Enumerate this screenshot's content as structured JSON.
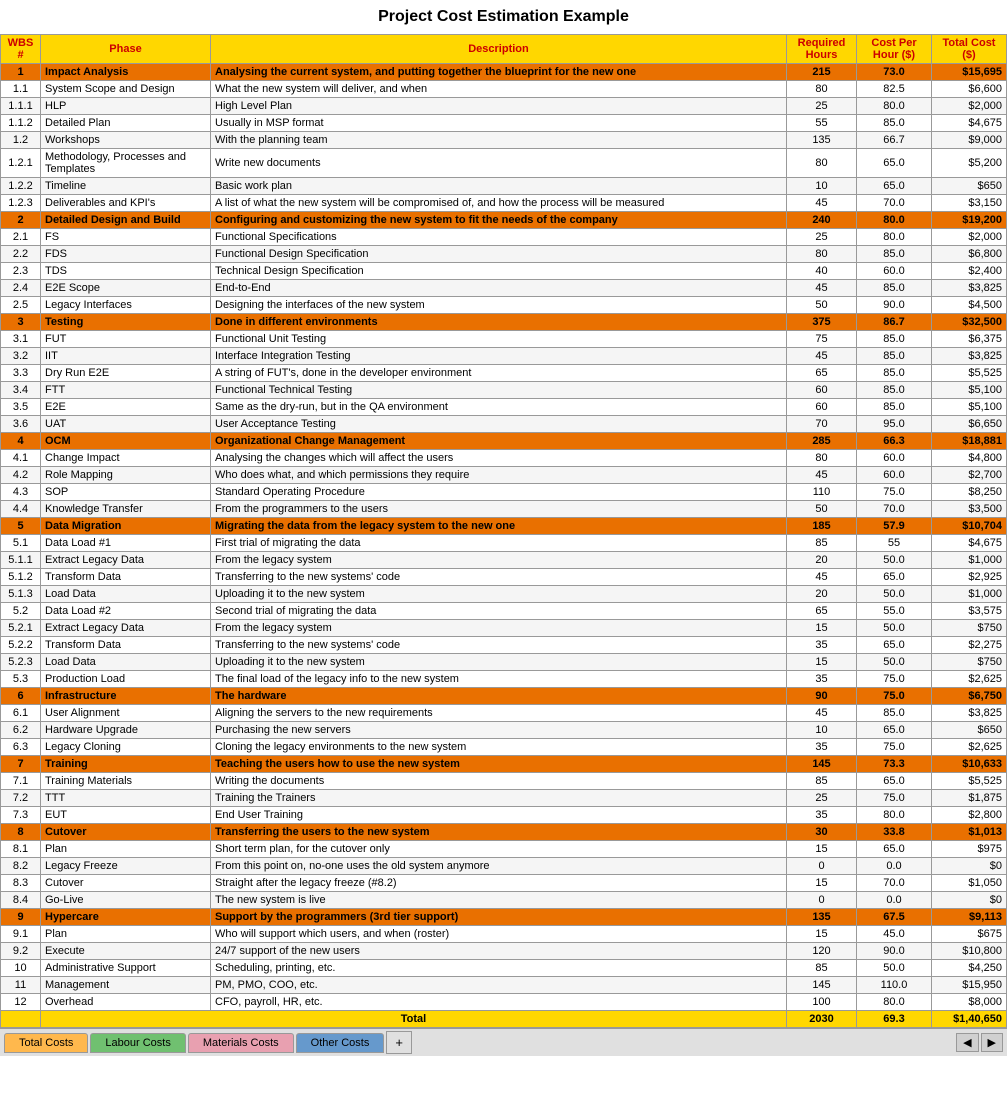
{
  "title": "Project Cost Estimation Example",
  "headers": {
    "wbs": "WBS #",
    "phase": "Phase",
    "description": "Description",
    "required_hours": "Required Hours",
    "cost_per_hour": "Cost Per Hour ($)",
    "total_cost": "Total Cost ($)"
  },
  "rows": [
    {
      "wbs": "1",
      "phase": "Impact Analysis",
      "desc": "Analysing the current system, and putting together the blueprint for the new one",
      "hours": "215",
      "cph": "73.0",
      "total": "$15,695",
      "type": "phase"
    },
    {
      "wbs": "1.1",
      "phase": "System Scope and Design",
      "desc": "What the new system will deliver, and when",
      "hours": "80",
      "cph": "82.5",
      "total": "$6,600",
      "type": "sub"
    },
    {
      "wbs": "1.1.1",
      "phase": "HLP",
      "desc": "High Level Plan",
      "hours": "25",
      "cph": "80.0",
      "total": "$2,000",
      "type": "alt"
    },
    {
      "wbs": "1.1.2",
      "phase": "Detailed Plan",
      "desc": "Usually in MSP format",
      "hours": "55",
      "cph": "85.0",
      "total": "$4,675",
      "type": "sub"
    },
    {
      "wbs": "1.2",
      "phase": "Workshops",
      "desc": "With the planning team",
      "hours": "135",
      "cph": "66.7",
      "total": "$9,000",
      "type": "alt"
    },
    {
      "wbs": "1.2.1",
      "phase": "Methodology, Processes and Templates",
      "desc": "Write new documents",
      "hours": "80",
      "cph": "65.0",
      "total": "$5,200",
      "type": "sub"
    },
    {
      "wbs": "1.2.2",
      "phase": "Timeline",
      "desc": "Basic work plan",
      "hours": "10",
      "cph": "65.0",
      "total": "$650",
      "type": "alt"
    },
    {
      "wbs": "1.2.3",
      "phase": "Deliverables and KPI's",
      "desc": "A list of what the new system will be compromised of, and how the process will be measured",
      "hours": "45",
      "cph": "70.0",
      "total": "$3,150",
      "type": "sub"
    },
    {
      "wbs": "2",
      "phase": "Detailed Design and Build",
      "desc": "Configuring and customizing the new system to fit the needs of the company",
      "hours": "240",
      "cph": "80.0",
      "total": "$19,200",
      "type": "phase"
    },
    {
      "wbs": "2.1",
      "phase": "FS",
      "desc": "Functional Specifications",
      "hours": "25",
      "cph": "80.0",
      "total": "$2,000",
      "type": "sub"
    },
    {
      "wbs": "2.2",
      "phase": "FDS",
      "desc": "Functional Design Specification",
      "hours": "80",
      "cph": "85.0",
      "total": "$6,800",
      "type": "alt"
    },
    {
      "wbs": "2.3",
      "phase": "TDS",
      "desc": "Technical Design Specification",
      "hours": "40",
      "cph": "60.0",
      "total": "$2,400",
      "type": "sub"
    },
    {
      "wbs": "2.4",
      "phase": "E2E Scope",
      "desc": "End-to-End",
      "hours": "45",
      "cph": "85.0",
      "total": "$3,825",
      "type": "alt"
    },
    {
      "wbs": "2.5",
      "phase": "Legacy Interfaces",
      "desc": "Designing the interfaces of the new system",
      "hours": "50",
      "cph": "90.0",
      "total": "$4,500",
      "type": "sub"
    },
    {
      "wbs": "3",
      "phase": "Testing",
      "desc": "Done in different environments",
      "hours": "375",
      "cph": "86.7",
      "total": "$32,500",
      "type": "phase"
    },
    {
      "wbs": "3.1",
      "phase": "FUT",
      "desc": "Functional Unit Testing",
      "hours": "75",
      "cph": "85.0",
      "total": "$6,375",
      "type": "sub"
    },
    {
      "wbs": "3.2",
      "phase": "IIT",
      "desc": "Interface Integration Testing",
      "hours": "45",
      "cph": "85.0",
      "total": "$3,825",
      "type": "alt"
    },
    {
      "wbs": "3.3",
      "phase": "Dry Run E2E",
      "desc": "A string of FUT's, done in the developer environment",
      "hours": "65",
      "cph": "85.0",
      "total": "$5,525",
      "type": "sub"
    },
    {
      "wbs": "3.4",
      "phase": "FTT",
      "desc": "Functional Technical Testing",
      "hours": "60",
      "cph": "85.0",
      "total": "$5,100",
      "type": "alt"
    },
    {
      "wbs": "3.5",
      "phase": "E2E",
      "desc": "Same as the dry-run, but in the QA environment",
      "hours": "60",
      "cph": "85.0",
      "total": "$5,100",
      "type": "sub"
    },
    {
      "wbs": "3.6",
      "phase": "UAT",
      "desc": "User Acceptance Testing",
      "hours": "70",
      "cph": "95.0",
      "total": "$6,650",
      "type": "alt"
    },
    {
      "wbs": "4",
      "phase": "OCM",
      "desc": "Organizational Change Management",
      "hours": "285",
      "cph": "66.3",
      "total": "$18,881",
      "type": "phase"
    },
    {
      "wbs": "4.1",
      "phase": "Change Impact",
      "desc": "Analysing the changes which will affect the users",
      "hours": "80",
      "cph": "60.0",
      "total": "$4,800",
      "type": "sub"
    },
    {
      "wbs": "4.2",
      "phase": "Role Mapping",
      "desc": "Who does what, and which permissions they require",
      "hours": "45",
      "cph": "60.0",
      "total": "$2,700",
      "type": "alt"
    },
    {
      "wbs": "4.3",
      "phase": "SOP",
      "desc": "Standard Operating Procedure",
      "hours": "110",
      "cph": "75.0",
      "total": "$8,250",
      "type": "sub"
    },
    {
      "wbs": "4.4",
      "phase": "Knowledge Transfer",
      "desc": "From the programmers to the users",
      "hours": "50",
      "cph": "70.0",
      "total": "$3,500",
      "type": "alt"
    },
    {
      "wbs": "5",
      "phase": "Data Migration",
      "desc": "Migrating the data from the legacy system to the new one",
      "hours": "185",
      "cph": "57.9",
      "total": "$10,704",
      "type": "phase"
    },
    {
      "wbs": "5.1",
      "phase": "Data Load #1",
      "desc": "First trial of migrating the data",
      "hours": "85",
      "cph": "55",
      "total": "$4,675",
      "type": "sub"
    },
    {
      "wbs": "5.1.1",
      "phase": "Extract Legacy Data",
      "desc": "From the legacy system",
      "hours": "20",
      "cph": "50.0",
      "total": "$1,000",
      "type": "alt"
    },
    {
      "wbs": "5.1.2",
      "phase": "Transform Data",
      "desc": "Transferring to the new systems' code",
      "hours": "45",
      "cph": "65.0",
      "total": "$2,925",
      "type": "sub"
    },
    {
      "wbs": "5.1.3",
      "phase": "Load Data",
      "desc": "Uploading it to the new system",
      "hours": "20",
      "cph": "50.0",
      "total": "$1,000",
      "type": "alt"
    },
    {
      "wbs": "5.2",
      "phase": "Data Load #2",
      "desc": "Second trial of migrating the data",
      "hours": "65",
      "cph": "55.0",
      "total": "$3,575",
      "type": "sub"
    },
    {
      "wbs": "5.2.1",
      "phase": "Extract Legacy Data",
      "desc": "From the legacy system",
      "hours": "15",
      "cph": "50.0",
      "total": "$750",
      "type": "alt"
    },
    {
      "wbs": "5.2.2",
      "phase": "Transform Data",
      "desc": "Transferring to the new systems' code",
      "hours": "35",
      "cph": "65.0",
      "total": "$2,275",
      "type": "sub"
    },
    {
      "wbs": "5.2.3",
      "phase": "Load Data",
      "desc": "Uploading it to the new system",
      "hours": "15",
      "cph": "50.0",
      "total": "$750",
      "type": "alt"
    },
    {
      "wbs": "5.3",
      "phase": "Production Load",
      "desc": "The final load of the legacy info to the new system",
      "hours": "35",
      "cph": "75.0",
      "total": "$2,625",
      "type": "sub"
    },
    {
      "wbs": "6",
      "phase": "Infrastructure",
      "desc": "The hardware",
      "hours": "90",
      "cph": "75.0",
      "total": "$6,750",
      "type": "phase"
    },
    {
      "wbs": "6.1",
      "phase": "User Alignment",
      "desc": "Aligning the servers to the new requirements",
      "hours": "45",
      "cph": "85.0",
      "total": "$3,825",
      "type": "sub"
    },
    {
      "wbs": "6.2",
      "phase": "Hardware Upgrade",
      "desc": "Purchasing the new servers",
      "hours": "10",
      "cph": "65.0",
      "total": "$650",
      "type": "alt"
    },
    {
      "wbs": "6.3",
      "phase": "Legacy Cloning",
      "desc": "Cloning the legacy environments to the new system",
      "hours": "35",
      "cph": "75.0",
      "total": "$2,625",
      "type": "sub"
    },
    {
      "wbs": "7",
      "phase": "Training",
      "desc": "Teaching the users how to use the new system",
      "hours": "145",
      "cph": "73.3",
      "total": "$10,633",
      "type": "phase"
    },
    {
      "wbs": "7.1",
      "phase": "Training Materials",
      "desc": "Writing the documents",
      "hours": "85",
      "cph": "65.0",
      "total": "$5,525",
      "type": "sub"
    },
    {
      "wbs": "7.2",
      "phase": "TTT",
      "desc": "Training the Trainers",
      "hours": "25",
      "cph": "75.0",
      "total": "$1,875",
      "type": "alt"
    },
    {
      "wbs": "7.3",
      "phase": "EUT",
      "desc": "End User Training",
      "hours": "35",
      "cph": "80.0",
      "total": "$2,800",
      "type": "sub"
    },
    {
      "wbs": "8",
      "phase": "Cutover",
      "desc": "Transferring the users to the new system",
      "hours": "30",
      "cph": "33.8",
      "total": "$1,013",
      "type": "phase"
    },
    {
      "wbs": "8.1",
      "phase": "Plan",
      "desc": "Short term plan, for the cutover only",
      "hours": "15",
      "cph": "65.0",
      "total": "$975",
      "type": "sub"
    },
    {
      "wbs": "8.2",
      "phase": "Legacy Freeze",
      "desc": "From this point on, no-one uses the old system anymore",
      "hours": "0",
      "cph": "0.0",
      "total": "$0",
      "type": "alt"
    },
    {
      "wbs": "8.3",
      "phase": "Cutover",
      "desc": "Straight after the legacy freeze (#8.2)",
      "hours": "15",
      "cph": "70.0",
      "total": "$1,050",
      "type": "sub"
    },
    {
      "wbs": "8.4",
      "phase": "Go-Live",
      "desc": "The new system is live",
      "hours": "0",
      "cph": "0.0",
      "total": "$0",
      "type": "alt"
    },
    {
      "wbs": "9",
      "phase": "Hypercare",
      "desc": "Support by the programmers (3rd tier support)",
      "hours": "135",
      "cph": "67.5",
      "total": "$9,113",
      "type": "phase"
    },
    {
      "wbs": "9.1",
      "phase": "Plan",
      "desc": "Who will support which users, and when (roster)",
      "hours": "15",
      "cph": "45.0",
      "total": "$675",
      "type": "sub"
    },
    {
      "wbs": "9.2",
      "phase": "Execute",
      "desc": "24/7 support of the new users",
      "hours": "120",
      "cph": "90.0",
      "total": "$10,800",
      "type": "alt"
    },
    {
      "wbs": "10",
      "phase": "Administrative Support",
      "desc": "Scheduling, printing, etc.",
      "hours": "85",
      "cph": "50.0",
      "total": "$4,250",
      "type": "sub"
    },
    {
      "wbs": "11",
      "phase": "Management",
      "desc": "PM, PMO, COO, etc.",
      "hours": "145",
      "cph": "110.0",
      "total": "$15,950",
      "type": "alt"
    },
    {
      "wbs": "12",
      "phase": "Overhead",
      "desc": "CFO, payroll, HR, etc.",
      "hours": "100",
      "cph": "80.0",
      "total": "$8,000",
      "type": "sub"
    },
    {
      "wbs": "",
      "phase": "Total",
      "desc": "",
      "hours": "2030",
      "cph": "69.3",
      "total": "$1,40,650",
      "type": "total"
    }
  ],
  "tabs": [
    {
      "label": "Total Costs",
      "class": "active-orange"
    },
    {
      "label": "Labour Costs",
      "class": "active-green"
    },
    {
      "label": "Materials Costs",
      "class": "active-pink"
    },
    {
      "label": "Other Costs",
      "class": "active-blue"
    }
  ],
  "tab_plus": "+",
  "total_row": {
    "label": "Total",
    "hours": "2030",
    "cph": "69.3",
    "total": "$1,40,650"
  }
}
